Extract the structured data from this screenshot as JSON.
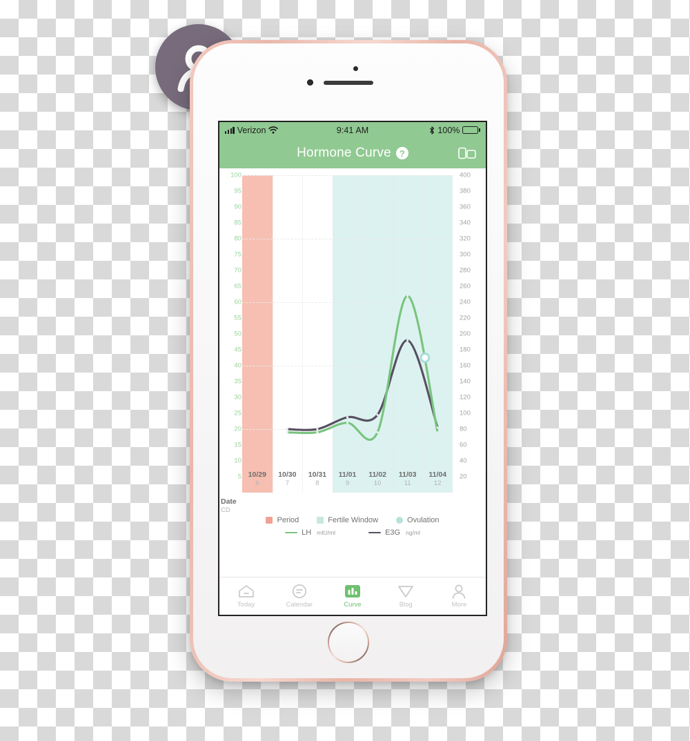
{
  "device": {
    "frame_color": "#eab7ab",
    "speaker_name": "earpiece-speaker",
    "camera_name": "front-camera"
  },
  "avatar": {
    "icon": "person-icon",
    "bg_color": "#776b7c"
  },
  "status_bar": {
    "carrier": "Verizon",
    "wifi_icon": "wifi-icon",
    "signal_icon": "signal-bars-icon",
    "time": "9:41 AM",
    "bluetooth_icon": "bluetooth-icon",
    "battery_text": "100%",
    "battery_icon": "battery-full-icon"
  },
  "nav_bar": {
    "title": "Hormone Curve",
    "help_label": "?",
    "help_icon": "question-mark-icon",
    "device_icon": "device-share-icon",
    "bg_color": "#90c992"
  },
  "chart_data": {
    "type": "line",
    "title": "Hormone Curve",
    "x": [
      "10/29",
      "10/30",
      "10/31",
      "11/01",
      "11/02",
      "11/03",
      "11/04"
    ],
    "cycle_days": [
      "6",
      "7",
      "8",
      "9",
      "10",
      "11",
      "12"
    ],
    "x_header_date": "Date",
    "x_header_cd": "CD",
    "grid": true,
    "legend_position": "bottom",
    "left_axis": {
      "label": "LH mIU/ml",
      "color": "#9ad39d",
      "ylim": [
        0,
        100
      ],
      "ticks": [
        100,
        95,
        90,
        85,
        80,
        75,
        70,
        65,
        60,
        55,
        50,
        45,
        40,
        35,
        30,
        25,
        20,
        15,
        10,
        5
      ]
    },
    "right_axis": {
      "label": "E3G ng/ml",
      "color": "#a3a3a3",
      "ylim": [
        0,
        400
      ],
      "ticks": [
        400,
        380,
        360,
        340,
        320,
        300,
        280,
        260,
        240,
        220,
        200,
        180,
        160,
        140,
        120,
        100,
        80,
        60,
        40,
        20
      ]
    },
    "series": [
      {
        "name": "LH",
        "unit": "mIU/ml",
        "color": "#79c47f",
        "axis": "left",
        "values": [
          null,
          19,
          19,
          22,
          19,
          62,
          19
        ]
      },
      {
        "name": "E3G",
        "unit": "ng/ml",
        "color": "#575060",
        "axis": "right",
        "values": [
          null,
          80,
          80,
          95,
          98,
          192,
          82
        ]
      }
    ],
    "bands": [
      {
        "name": "Period",
        "color": "#f6bfb1",
        "start": "10/29",
        "end": "10/29"
      },
      {
        "name": "Fertile Window",
        "color": "#dcf2f0",
        "start": "11/01",
        "end": "11/04"
      }
    ],
    "markers": [
      {
        "name": "Ovulation",
        "color": "#9fd9d4",
        "date": "11/04",
        "value": 170
      }
    ]
  },
  "legend": {
    "row1": [
      {
        "label": "Period",
        "color": "#f0a193",
        "shape": "square"
      },
      {
        "label": "Fertile Window",
        "color": "#c6e8e2",
        "shape": "square"
      },
      {
        "label": "Ovulation",
        "color": "#b6e2dd",
        "shape": "circle"
      }
    ],
    "row2": [
      {
        "label": "LH",
        "unit": "mIU/ml",
        "color": "#79c47f"
      },
      {
        "label": "E3G",
        "unit": "ng/ml",
        "color": "#575060"
      }
    ]
  },
  "tab_bar": {
    "active": "Curve",
    "active_color": "#6fc06f",
    "items": [
      {
        "label": "Today",
        "icon": "home-icon"
      },
      {
        "label": "Calendar",
        "icon": "calendar-icon"
      },
      {
        "label": "Curve",
        "icon": "bar-chart-icon"
      },
      {
        "label": "Blog",
        "icon": "paper-plane-icon"
      },
      {
        "label": "More",
        "icon": "person-icon"
      }
    ]
  }
}
